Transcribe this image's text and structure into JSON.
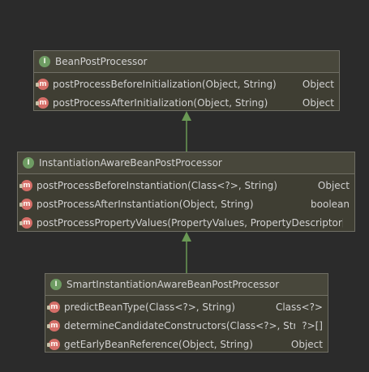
{
  "boxes": [
    {
      "name": "BeanPostProcessor",
      "methods": [
        {
          "sig": "postProcessBeforeInitialization(Object, String)",
          "ret": "Object"
        },
        {
          "sig": "postProcessAfterInitialization(Object, String)",
          "ret": "Object"
        }
      ]
    },
    {
      "name": "InstantiationAwareBeanPostProcessor",
      "methods": [
        {
          "sig": "postProcessBeforeInstantiation(Class<?>, String)",
          "ret": "Object"
        },
        {
          "sig": "postProcessAfterInstantiation(Object, String)",
          "ret": "boolean"
        },
        {
          "sig": "postProcessPropertyValues(PropertyValues, PropertyDescriptor[], O",
          "ret": ""
        }
      ]
    },
    {
      "name": "SmartInstantiationAwareBeanPostProcessor",
      "methods": [
        {
          "sig": "predictBeanType(Class<?>, String)",
          "ret": "Class<?>"
        },
        {
          "sig": "determineCandidateConstructors(Class<?>, String)",
          "ret": "?>[]"
        },
        {
          "sig": "getEarlyBeanReference(Object, String)",
          "ret": "Object"
        }
      ]
    }
  ],
  "icons": {
    "interface": "I",
    "method": "m"
  },
  "colors": {
    "background": "#2b2b2b",
    "box": "#3f3e33",
    "border": "#706f65",
    "arrow": "#6a9955"
  }
}
